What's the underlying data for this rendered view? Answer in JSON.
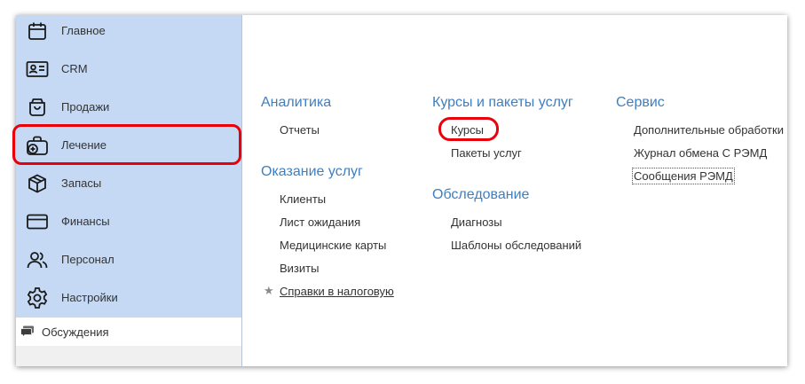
{
  "sidebar": {
    "items": [
      {
        "label": "Главное",
        "icon": "calendar-icon"
      },
      {
        "label": "CRM",
        "icon": "id-card-icon"
      },
      {
        "label": "Продажи",
        "icon": "shopping-bag-icon"
      },
      {
        "label": "Лечение",
        "icon": "medical-bag-icon"
      },
      {
        "label": "Запасы",
        "icon": "box-icon"
      },
      {
        "label": "Финансы",
        "icon": "credit-card-icon"
      },
      {
        "label": "Персонал",
        "icon": "people-icon"
      },
      {
        "label": "Настройки",
        "icon": "gear-icon"
      }
    ],
    "discussions": {
      "label": "Обсуждения",
      "icon": "chat-icon"
    }
  },
  "sections": {
    "analytics": {
      "title": "Аналитика",
      "links": [
        "Отчеты"
      ]
    },
    "services": {
      "title": "Оказание услуг",
      "links": [
        "Клиенты",
        "Лист ожидания",
        "Медицинские карты",
        "Визиты",
        "Справки в налоговую"
      ]
    },
    "courses": {
      "title": "Курсы и пакеты услуг",
      "links": [
        "Курсы",
        "Пакеты услуг"
      ]
    },
    "examination": {
      "title": "Обследование",
      "links": [
        "Диагнозы",
        "Шаблоны обследований"
      ]
    },
    "service": {
      "title": "Сервис",
      "links": [
        "Дополнительные обработки",
        "Журнал обмена С РЭМД",
        "Сообщения РЭМД"
      ]
    }
  },
  "colors": {
    "sidebar_bg": "#c5d9f4",
    "section_title": "#3e7fc1",
    "highlight": "#e8000b"
  }
}
